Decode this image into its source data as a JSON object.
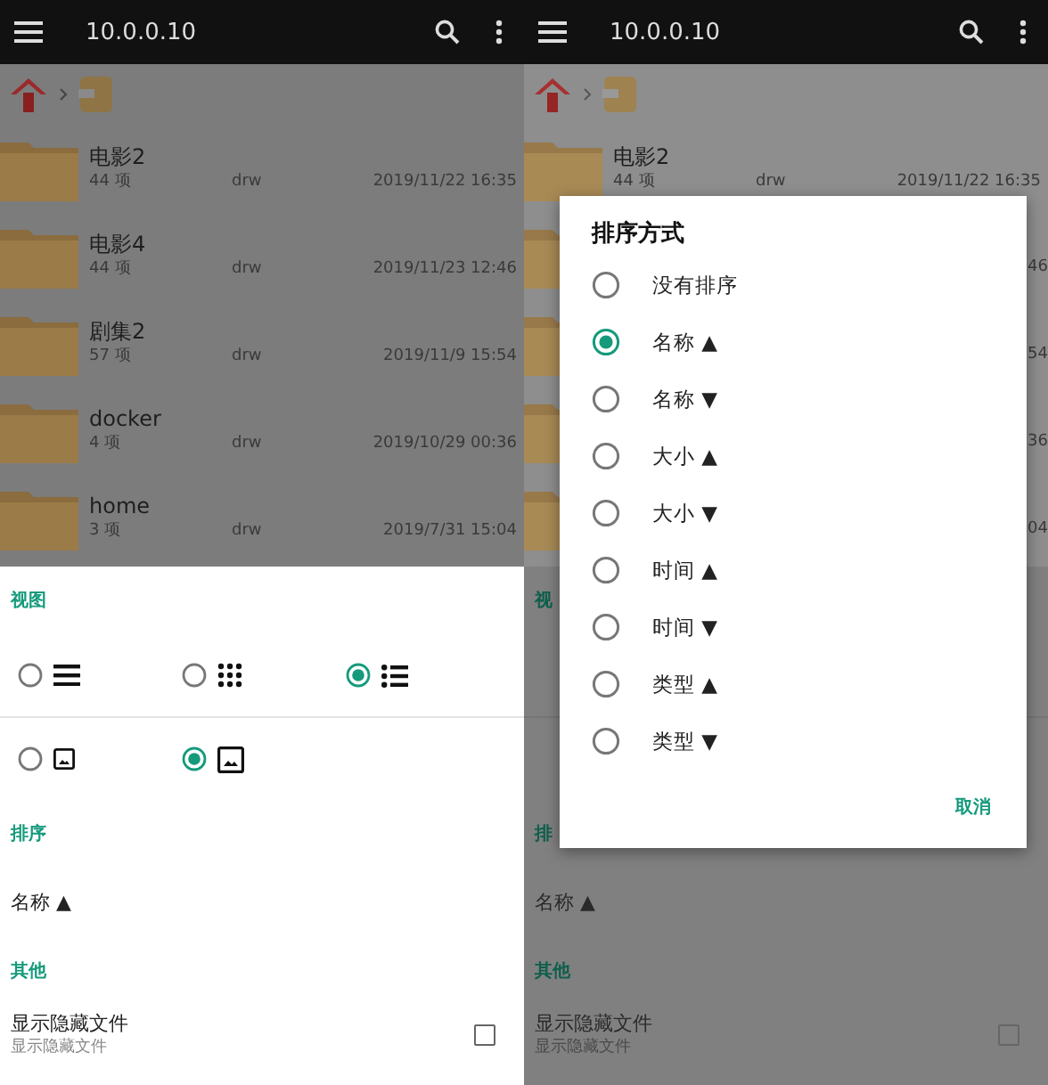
{
  "left_screen": {
    "toolbar": {
      "title": "10.0.0.10"
    },
    "file_rows": [
      {
        "title": "电影2",
        "count": "44 项",
        "perm": "drw",
        "date": "2019/11/22 16:35"
      },
      {
        "title": "电影4",
        "count": "44 项",
        "perm": "drw",
        "date": "2019/11/23 12:46"
      },
      {
        "title": "剧集2",
        "count": "57 项",
        "perm": "drw",
        "date": "2019/11/9 15:54"
      },
      {
        "title": "docker",
        "count": "4 项",
        "perm": "drw",
        "date": "2019/10/29 00:36"
      },
      {
        "title": "home",
        "count": "3 项",
        "perm": "drw",
        "date": "2019/7/31 15:04"
      }
    ],
    "view_section": {
      "title": "视图",
      "layout_options": [
        {
          "kind": "lines",
          "selected": false
        },
        {
          "kind": "grid",
          "selected": false
        },
        {
          "kind": "list",
          "selected": true
        }
      ],
      "thumbnail_options": [
        {
          "kind": "small",
          "selected": false
        },
        {
          "kind": "large",
          "selected": true
        }
      ]
    },
    "sort_section": {
      "title": "排序",
      "value": "名称 ▲"
    },
    "other_section": {
      "title": "其他",
      "items": [
        {
          "label": "显示隐藏文件",
          "description": "显示隐藏文件",
          "checked": false
        }
      ]
    }
  },
  "right_screen": {
    "toolbar": {
      "title": "10.0.0.10"
    },
    "file_row": {
      "title": "电影2",
      "count": "44 项",
      "perm": "drw",
      "date": "2019/11/22 16:35"
    },
    "row_fragments": [
      "46",
      "54",
      "36",
      "04"
    ],
    "section_fragments": [
      "视",
      "排"
    ],
    "sort_value": "名称 ▲",
    "other_section": {
      "title": "其他",
      "items": [
        {
          "label": "显示隐藏文件",
          "description": "显示隐藏文件",
          "checked": false
        }
      ]
    },
    "sort_dialog": {
      "title": "排序方式",
      "options": [
        {
          "label": "没有排序",
          "selected": false
        },
        {
          "label": "名称 ▲",
          "selected": true
        },
        {
          "label": "名称 ▼",
          "selected": false
        },
        {
          "label": "大小 ▲",
          "selected": false
        },
        {
          "label": "大小 ▼",
          "selected": false
        },
        {
          "label": "时间 ▲",
          "selected": false
        },
        {
          "label": "时间 ▼",
          "selected": false
        },
        {
          "label": "类型 ▲",
          "selected": false
        },
        {
          "label": "类型 ▼",
          "selected": false
        }
      ],
      "cancel": "取消"
    }
  }
}
